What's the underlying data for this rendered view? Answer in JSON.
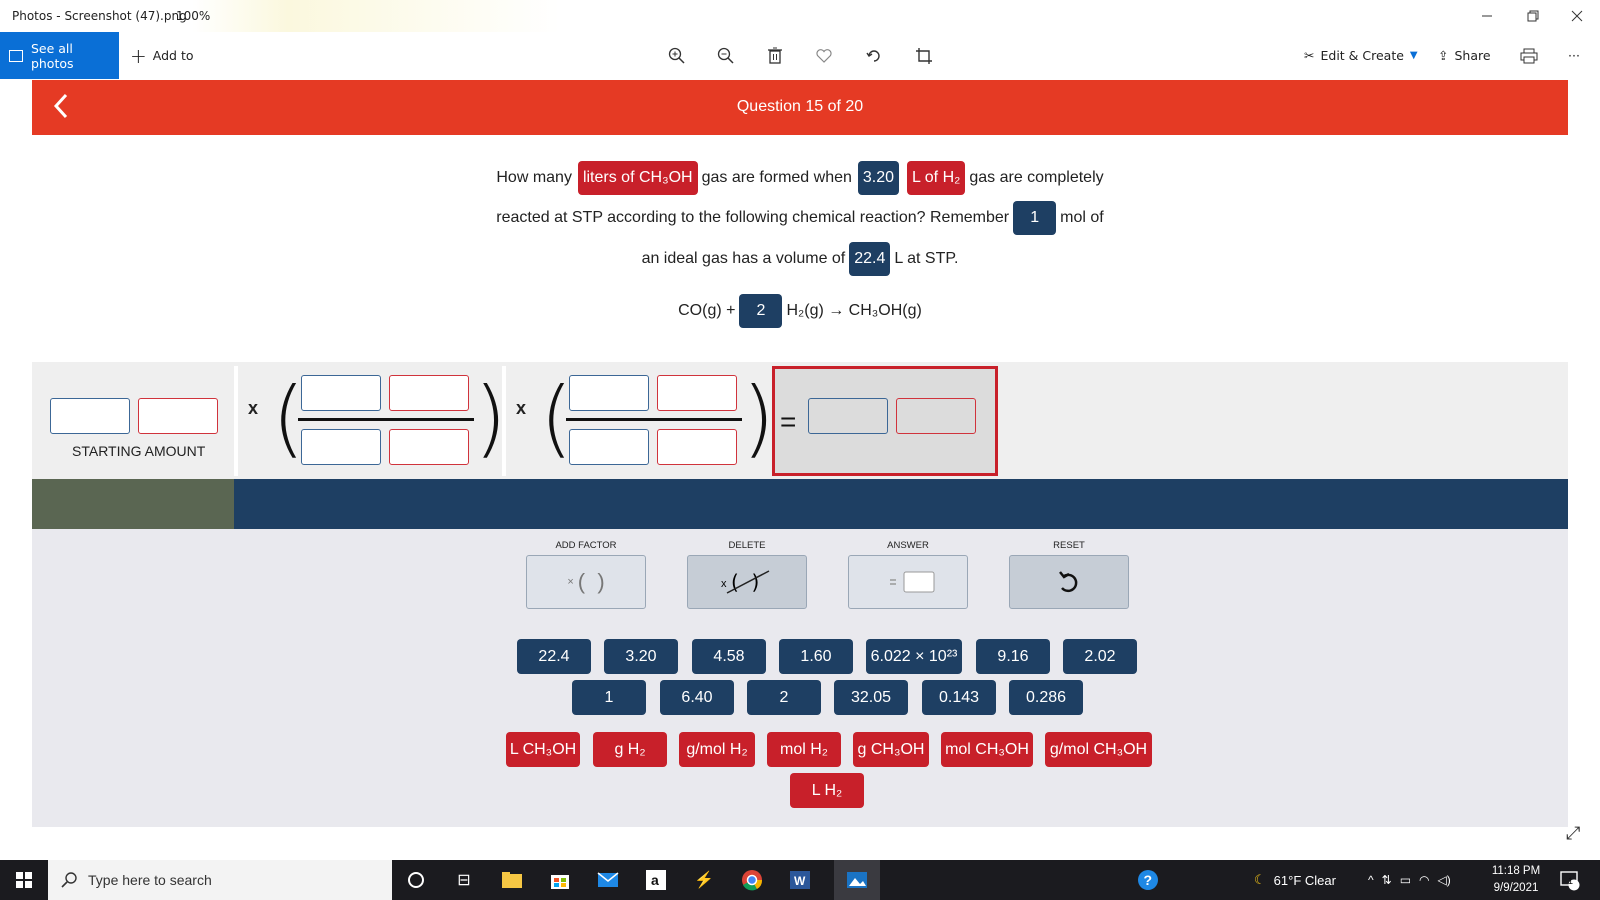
{
  "titlebar": {
    "title": "Photos - Screenshot (47).png",
    "zoom": "100%"
  },
  "toolbar": {
    "see_all": "See all photos",
    "add_to": "Add to",
    "edit_create": "Edit & Create",
    "share": "Share",
    "more": "···"
  },
  "question": {
    "header": "Question 15 of 20",
    "line1": {
      "pre": "How many",
      "chip1": "liters of CH₃OH",
      "mid": "gas are formed when",
      "chip2": "3.20",
      "chip3": "L of H₂",
      "post": "gas are completely"
    },
    "line2": {
      "pre": "reacted at STP according to the following chemical reaction? Remember",
      "chip": "1",
      "post": "mol of"
    },
    "line3": {
      "pre": "an ideal gas has a volume of",
      "chip": "22.4",
      "post": "L at STP."
    },
    "reaction": {
      "pre": "CO(g) +",
      "coef": "2",
      "post": "H₂(g) → CH₃OH(g)"
    }
  },
  "workarea": {
    "starting_amount": "STARTING AMOUNT",
    "x": "x",
    "equals": "="
  },
  "controls": {
    "add_factor": "ADD FACTOR",
    "delete": "DELETE",
    "answer": "ANSWER",
    "reset": "RESET"
  },
  "numbers_row1": [
    "22.4",
    "3.20",
    "4.58",
    "1.60",
    "6.022 × 10²³",
    "9.16",
    "2.02"
  ],
  "numbers_row2": [
    "1",
    "6.40",
    "2",
    "32.05",
    "0.143",
    "0.286"
  ],
  "units_row1": [
    "L CH₃OH",
    "g H₂",
    "g/mol H₂",
    "mol H₂",
    "g CH₃OH",
    "mol CH₃OH",
    "g/mol CH₃OH"
  ],
  "units_row2": [
    "L H₂"
  ],
  "taskbar": {
    "search_placeholder": "Type here to search",
    "weather": "61°F  Clear",
    "time": "11:18 PM",
    "date": "9/9/2021",
    "notif_count": "1"
  },
  "colors": {
    "red": "#e53a24",
    "navy": "#1e3f63",
    "chip_red": "#c8202a"
  }
}
